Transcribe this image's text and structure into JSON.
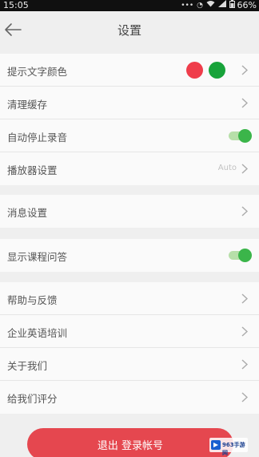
{
  "status_bar": {
    "time": "15:05",
    "battery": "66%",
    "icons": [
      "more-icon",
      "alarm-icon",
      "wifi-icon",
      "signal-icon",
      "battery-icon"
    ]
  },
  "header": {
    "title": "设置",
    "back_icon": "back-arrow-icon"
  },
  "sections": {
    "general": {
      "text_color_label": "提示文字颜色",
      "color_options": [
        "#ef3d4b",
        "#18a33a"
      ],
      "clear_cache_label": "清理缓存",
      "auto_stop_label": "自动停止录音",
      "auto_stop_on": true,
      "player_label": "播放器设置",
      "player_value": "Auto"
    },
    "message": {
      "message_label": "消息设置"
    },
    "course": {
      "show_qa_label": "显示课程问答",
      "show_qa_on": true
    },
    "about": {
      "help_label": "帮助与反馈",
      "enterprise_label": "企业英语培训",
      "about_label": "关于我们",
      "rate_label": "给我们评分"
    }
  },
  "logout": {
    "label": "退出 登录帐号"
  },
  "watermark": {
    "text": "963手游网"
  },
  "colors": {
    "accent_red": "#e5474f",
    "toggle_green": "#3bb54a"
  }
}
